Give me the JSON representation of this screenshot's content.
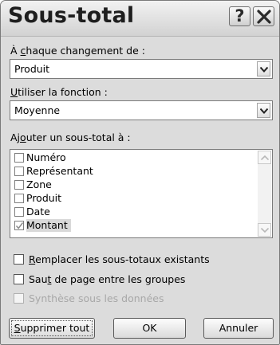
{
  "dialog": {
    "title": "Sous-total",
    "help_glyph": "?",
    "close_icon": "close-icon"
  },
  "group_by": {
    "label_before": "À ",
    "label_mnemonic": "c",
    "label_after": "haque changement de :",
    "value": "Produit"
  },
  "function": {
    "label_mnemonic": "U",
    "label_after": "tiliser la fonction :",
    "value": "Moyenne"
  },
  "add_to": {
    "label_before": "Aj",
    "label_mnemonic": "o",
    "label_after": "uter un sous-total à :",
    "items": [
      {
        "label": "Numéro",
        "checked": false
      },
      {
        "label": "Représentant",
        "checked": false
      },
      {
        "label": "Zone",
        "checked": false
      },
      {
        "label": "Produit",
        "checked": false
      },
      {
        "label": "Date",
        "checked": false
      },
      {
        "label": "Montant",
        "checked": true
      }
    ]
  },
  "options": {
    "replace": {
      "mnemonic": "R",
      "after": "emplacer les sous-totaux existants",
      "checked": false
    },
    "pagebreak": {
      "before": "Sau",
      "mnemonic": "t",
      "after": " de page entre les groupes",
      "checked": false
    },
    "summary": {
      "label": "Synthèse sous les données",
      "checked": false,
      "disabled": true
    }
  },
  "buttons": {
    "remove_all_mnemonic": "S",
    "remove_all_after": "upprimer tout",
    "ok": "OK",
    "cancel": "Annuler"
  }
}
